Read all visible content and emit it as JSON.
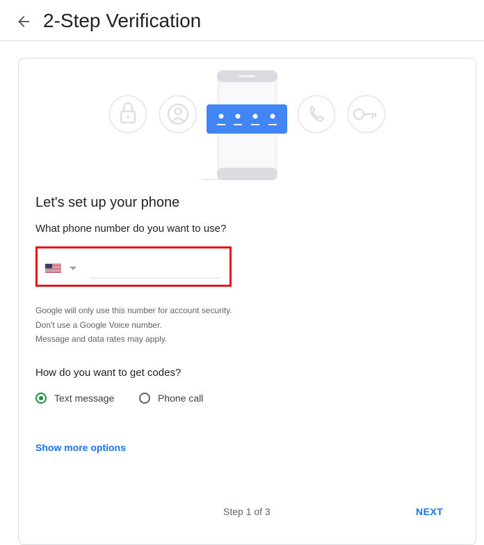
{
  "header": {
    "title": "2-Step Verification",
    "back_icon": "arrow-back-icon"
  },
  "illustration": {
    "icons": [
      "lock-icon",
      "account-circle-icon",
      "phone-icon",
      "key-icon"
    ],
    "code_card_icon": "password-dots-icon"
  },
  "setup": {
    "heading": "Let's set up your phone",
    "phone_question": "What phone number do you want to use?",
    "country_flag": "us-flag-icon",
    "phone_value": "",
    "notes": [
      "Google will only use this number for account security.",
      "Don't use a Google Voice number.",
      "Message and data rates may apply."
    ]
  },
  "codes": {
    "question": "How do you want to get codes?",
    "options": [
      {
        "label": "Text message",
        "selected": true
      },
      {
        "label": "Phone call",
        "selected": false
      }
    ]
  },
  "show_more": "Show more options",
  "footer": {
    "step": "Step 1 of 3",
    "next": "NEXT"
  },
  "colors": {
    "accent": "#1a73e8",
    "radio_selected": "#1e8e3e",
    "highlight_border": "#e8141c"
  }
}
